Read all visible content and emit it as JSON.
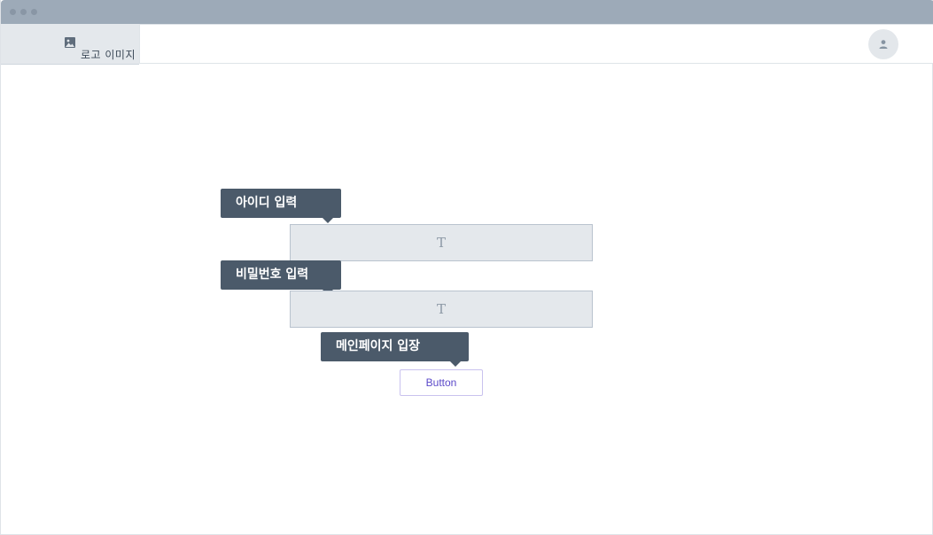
{
  "header": {
    "logo_icon": "image-icon",
    "logo_text": "로고 이미지",
    "avatar_icon": "user-icon"
  },
  "form": {
    "id_tooltip": "아이디 입력",
    "id_field_glyph": "T",
    "password_tooltip": "비밀번호 입력",
    "password_field_glyph": "T",
    "enter_tooltip": "메인페이지 입장",
    "button_label": "Button"
  },
  "colors": {
    "titlebar": "#9daab8",
    "tooltip_bg": "#4b5a6a",
    "field_bg": "#e4e8ec",
    "button_text": "#5b49c9"
  }
}
